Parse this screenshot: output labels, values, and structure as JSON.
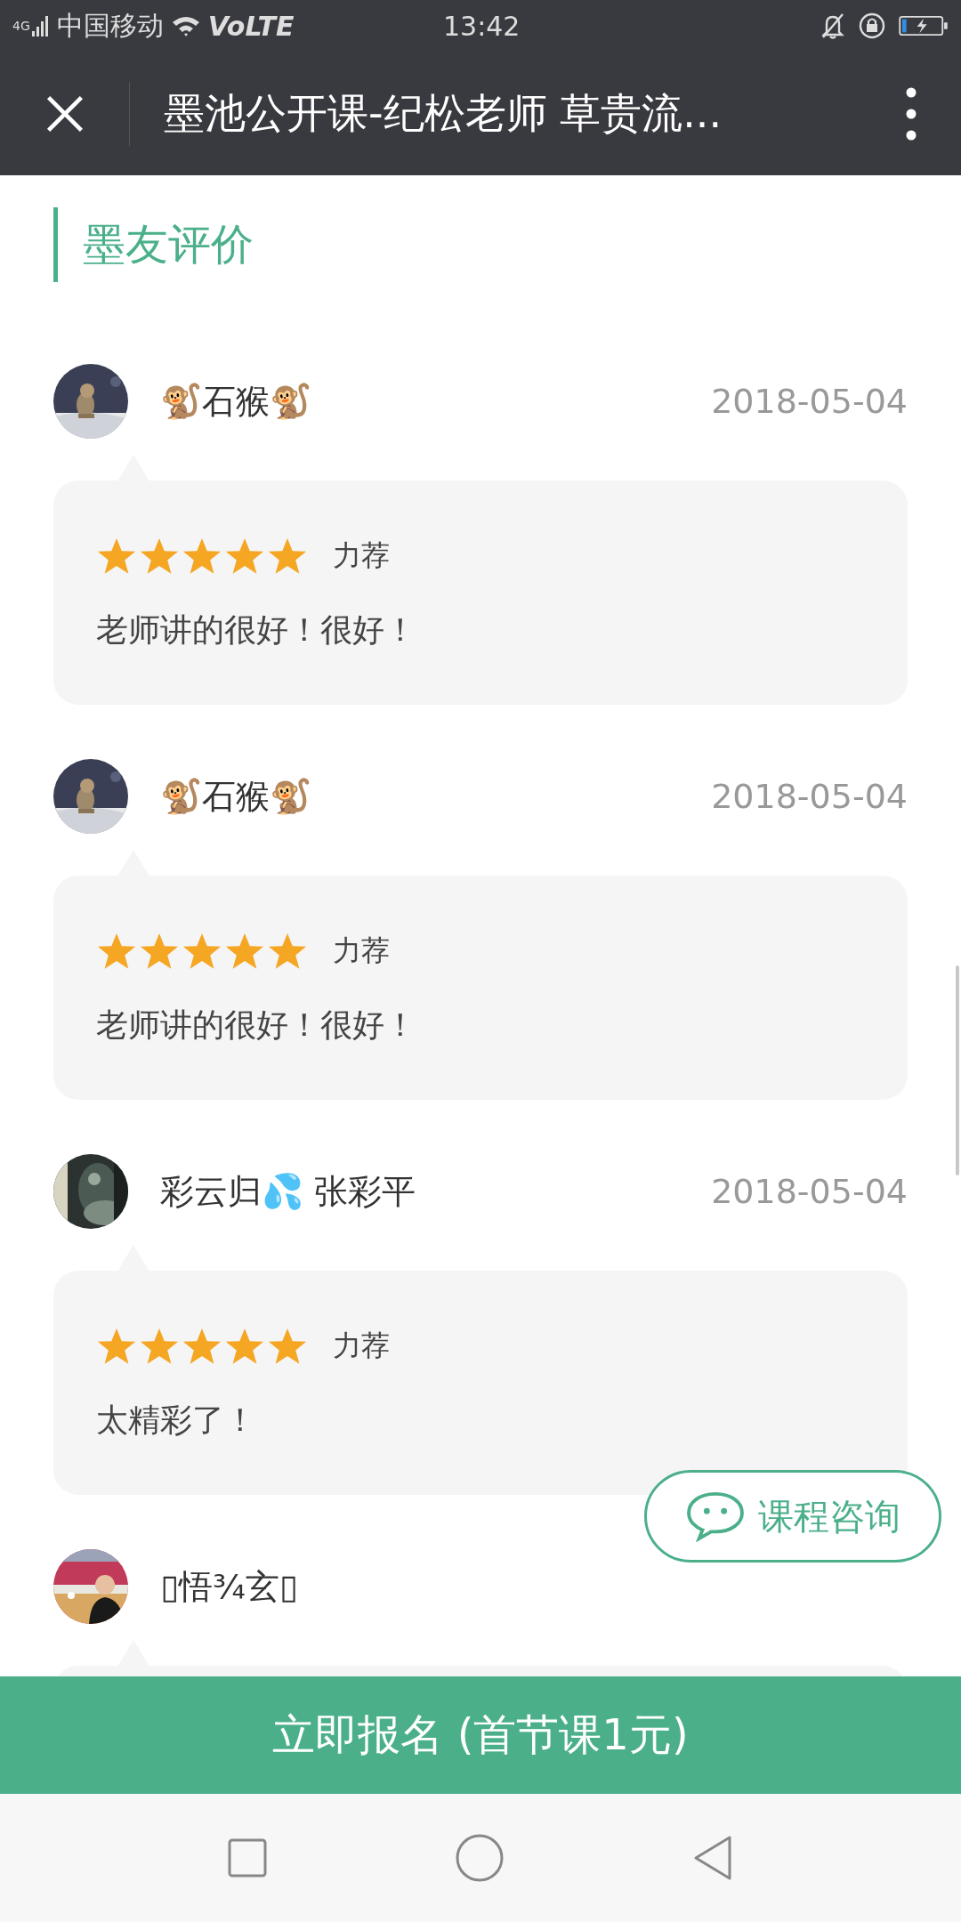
{
  "status_bar": {
    "network": "4G",
    "carrier": "中国移动",
    "volte": "VoLTE",
    "time": "13:42"
  },
  "header": {
    "title": "墨池公开课-纪松老师 草贵流..."
  },
  "section": {
    "title": "墨友评价"
  },
  "reviews": [
    {
      "name": "🐒石猴🐒",
      "date": "2018-05-04",
      "stars": 5,
      "tag": "力荐",
      "text": "老师讲的很好！很好！"
    },
    {
      "name": "🐒石猴🐒",
      "date": "2018-05-04",
      "stars": 5,
      "tag": "力荐",
      "text": "老师讲的很好！很好！"
    },
    {
      "name": "彩云归💦 张彩平",
      "date": "2018-05-04",
      "stars": 5,
      "tag": "力荐",
      "text": "太精彩了！"
    },
    {
      "name": "▯悟¾玄▯"
    }
  ],
  "consult_button": {
    "label": "课程咨询"
  },
  "enroll_button": {
    "label": "立即报名 (首节课1元)"
  }
}
